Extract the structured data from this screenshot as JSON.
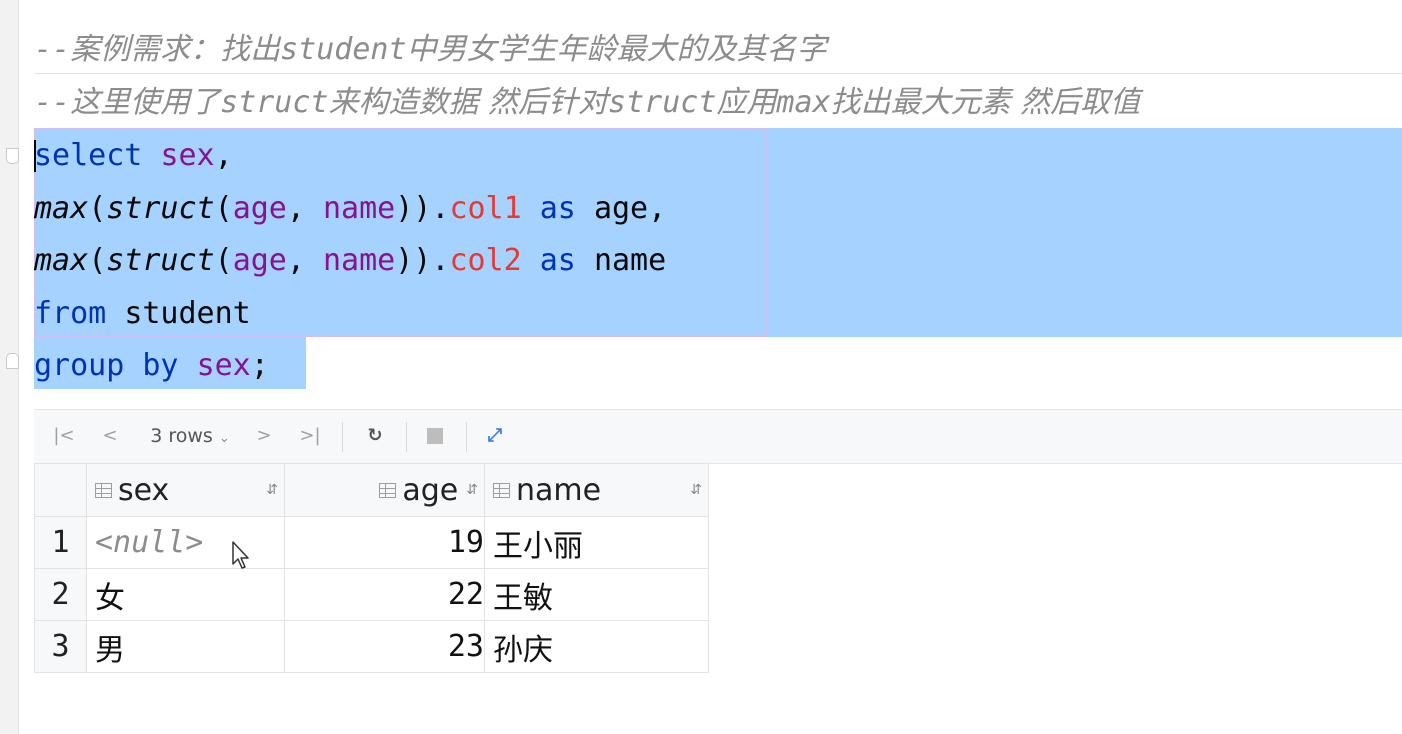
{
  "editor": {
    "comment1_prefix": "--",
    "comment1_cjk_a": "案例需求：找出",
    "comment1_ascii": "student",
    "comment1_cjk_b": "中男女学生年龄最大的及其名字",
    "comment2_prefix": "--",
    "comment2_cjk_a": "这里使用了",
    "comment2_ascii_a": "struct",
    "comment2_cjk_b": "来构造数据 然后针对",
    "comment2_ascii_b": "struct",
    "comment2_cjk_c": "应用",
    "comment2_ascii_c": "max",
    "comment2_cjk_d": "找出最大元素 然后取值",
    "sql": {
      "select_kw": "select",
      "sex": "sex",
      "comma": ",",
      "max_fn": "max",
      "open": "(",
      "struct_fn": "struct",
      "age": "age",
      "comma_space": ", ",
      "name": "name",
      "close_dot": ")).",
      "col1": "col1",
      "col2": "col2",
      "as_kw": "as",
      "alias_age": "age,",
      "alias_name": "name",
      "from_kw": "from",
      "table": "student",
      "group_by_kw": "group by",
      "semicolon": ";"
    }
  },
  "results": {
    "toolbar": {
      "first_icon": "first-page-icon",
      "prev_icon": "prev-page-icon",
      "rows_label": "3 rows",
      "next_icon": "next-page-icon",
      "last_icon": "last-page-icon",
      "refresh_icon": "refresh-icon",
      "stop_icon": "stop-icon",
      "pin_icon": "pin-icon"
    },
    "columns": [
      "sex",
      "age",
      "name"
    ],
    "rows": [
      {
        "num": "1",
        "sex": "<null>",
        "age": "19",
        "name": "王小丽"
      },
      {
        "num": "2",
        "sex": "女",
        "age": "22",
        "name": "王敏"
      },
      {
        "num": "3",
        "sex": "男",
        "age": "23",
        "name": "孙庆"
      }
    ]
  }
}
